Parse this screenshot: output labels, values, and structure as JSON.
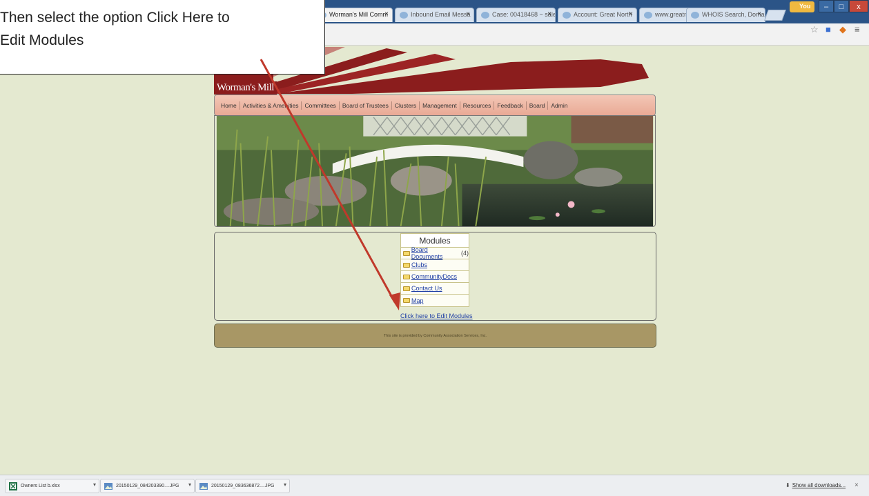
{
  "callout": {
    "line1": "Then select the option Click Here to",
    "line2": "Edit Modules"
  },
  "browser": {
    "tabs": [
      {
        "label": "Worman's Mill Comm",
        "close": "×",
        "active": true
      },
      {
        "label": "Inbound Email Messa",
        "close": "×",
        "active": false
      },
      {
        "label": "Case: 00418468 ~ sale",
        "close": "×",
        "active": false
      },
      {
        "label": "Account: Great North",
        "close": "×",
        "active": false
      },
      {
        "label": "www.greatnorthwest.",
        "close": "×",
        "active": false
      },
      {
        "label": "WHOIS Search, Doma",
        "close": "×",
        "active": false
      }
    ],
    "user_badge": "You",
    "win_min": "–",
    "win_max": "□",
    "win_close": "x"
  },
  "site": {
    "logo": "Worman's Mill",
    "nav": [
      "Home",
      "Activities & Amenities",
      "Committees",
      "Board of Trustees",
      "Clusters",
      "Management",
      "Resources",
      "Feedback",
      "Board",
      "Admin"
    ],
    "modules_title": "Modules",
    "modules": [
      {
        "label": "Board Documents",
        "count": "(4)"
      },
      {
        "label": "Clubs",
        "count": ""
      },
      {
        "label": "CommunityDocs",
        "count": ""
      },
      {
        "label": "Contact Us",
        "count": ""
      },
      {
        "label": "Map",
        "count": ""
      }
    ],
    "edit_link": "Click here to Edit Modules",
    "footer": "This site is provided by Community Association Services, Inc."
  },
  "downloads": {
    "items": [
      {
        "label": "Owners List b.xlsx",
        "icon": "excel-icon"
      },
      {
        "label": "20150129_084203390....JPG",
        "icon": "image-icon"
      },
      {
        "label": "20150129_083636872....JPG",
        "icon": "image-icon"
      }
    ],
    "show_all": "Show all downloads...",
    "close": "×"
  },
  "colors": {
    "page_bg": "#e4e9d0",
    "annotation_arrow": "#c0392b",
    "banner_red": "#8b1d1d"
  }
}
